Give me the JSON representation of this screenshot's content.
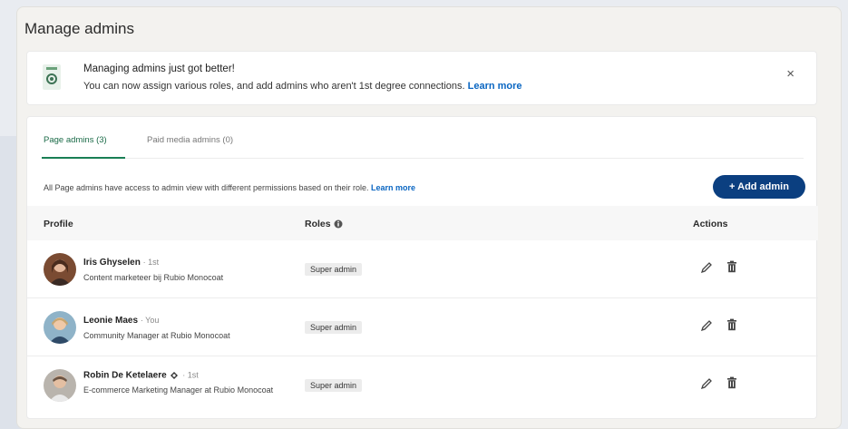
{
  "panel": {
    "title": "Manage admins"
  },
  "banner": {
    "heading": "Managing admins just got better!",
    "text": "You can now assign various roles, and add admins who aren't 1st degree connections.",
    "link": "Learn more",
    "close": "×"
  },
  "tabs": [
    {
      "label": "Page admins (3)",
      "active": true
    },
    {
      "label": "Paid media admins (0)",
      "active": false
    }
  ],
  "info": {
    "text": "All Page admins have access to admin view with different permissions based on their role.",
    "link": "Learn more"
  },
  "add_button": {
    "label": "+ Add admin"
  },
  "table": {
    "headers": {
      "profile": "Profile",
      "roles": "Roles",
      "actions": "Actions"
    },
    "rows": [
      {
        "name": "Iris Ghyselen",
        "degree": "· 1st",
        "subtitle": "Content marketeer bij Rubio Monocoat",
        "role": "Super admin"
      },
      {
        "name": "Leonie Maes",
        "degree": "· You",
        "subtitle": "Community Manager at Rubio Monocoat",
        "role": "Super admin"
      },
      {
        "name": "Robin De Ketelaere",
        "degree": "· 1st",
        "subtitle": "E-commerce Marketing Manager at Rubio Monocoat",
        "role": "Super admin"
      }
    ]
  },
  "colors": {
    "primary_button": "#0b3f80",
    "link": "#0a66c2",
    "tab_active": "#1a7f55"
  },
  "icons": {
    "banner": "admin-badge-icon",
    "edit": "pencil-icon",
    "delete": "trash-icon",
    "info": "info-icon",
    "verified": "verified-badge-icon",
    "close": "close-icon"
  }
}
